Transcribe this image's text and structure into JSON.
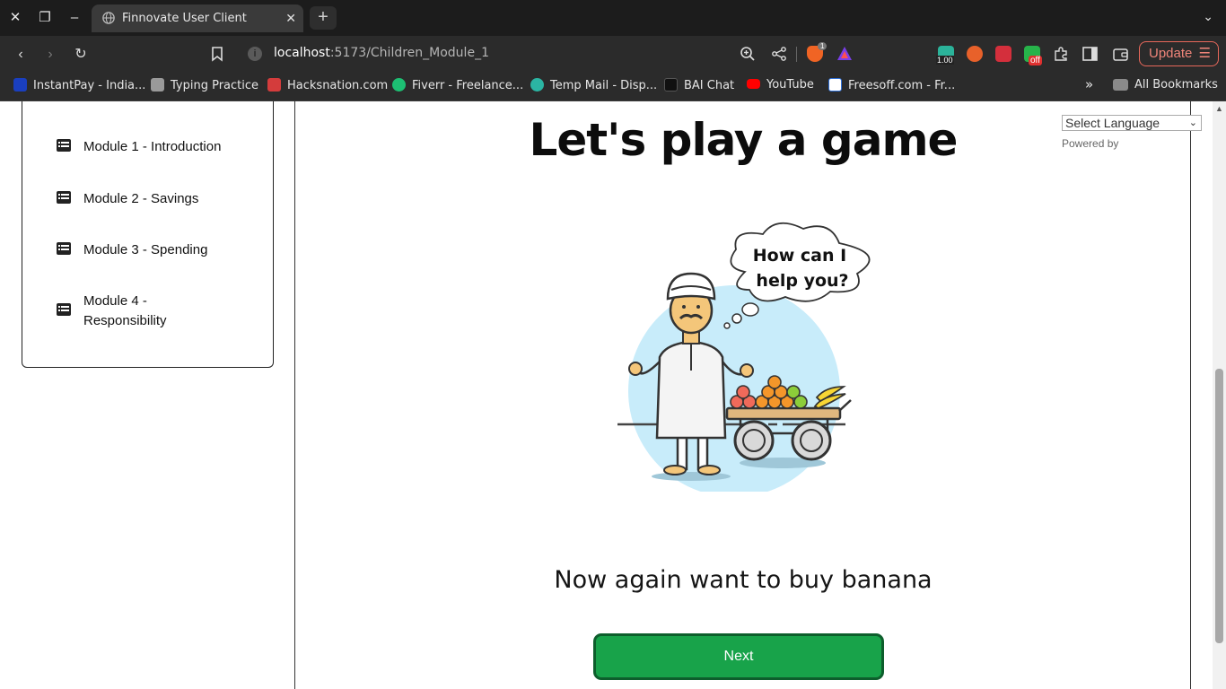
{
  "browser": {
    "tab_title": "Finnovate User Client",
    "url_host": "localhost",
    "url_rest": ":5173/Children_Module_1",
    "update_label": "Update",
    "brave_badge": "1",
    "ext_value": "1.00",
    "ext_off_label": "off",
    "bookmarks": [
      {
        "label": "InstantPay - India...",
        "color": "#1a3fbf"
      },
      {
        "label": "Typing Practice",
        "color": "#9a9a9a"
      },
      {
        "label": "Hacksnation.com",
        "color": "#d43c3c"
      },
      {
        "label": "Fiverr - Freelance...",
        "color": "#1dbf73"
      },
      {
        "label": "Temp Mail - Disp...",
        "color": "#2bb5a3"
      },
      {
        "label": "BAI Chat",
        "color": "#111111"
      },
      {
        "label": "YouTube",
        "color": "#ff0000"
      },
      {
        "label": "Freesoff.com - Fr...",
        "color": "#2f6fd6"
      }
    ],
    "all_bookmarks_label": "All Bookmarks",
    "more_label": "»"
  },
  "sidebar": {
    "items": [
      {
        "label": "Module 1 - Introduction"
      },
      {
        "label": "Module 2 - Savings"
      },
      {
        "label": "Module 3 - Spending"
      },
      {
        "label": "Module 4 - Responsibility"
      }
    ]
  },
  "main": {
    "title": "Let's play a game",
    "speech_bubble_line1": "How can I",
    "speech_bubble_line2": "help you?",
    "prompt": "Now again want to buy banana",
    "next_label": "Next"
  },
  "translate": {
    "select_label": "Select Language",
    "powered_by": "Powered by"
  },
  "colors": {
    "accent_green": "#18a34a",
    "accent_green_border": "#0d5e2c",
    "sky_circle": "#c8ecfa"
  }
}
